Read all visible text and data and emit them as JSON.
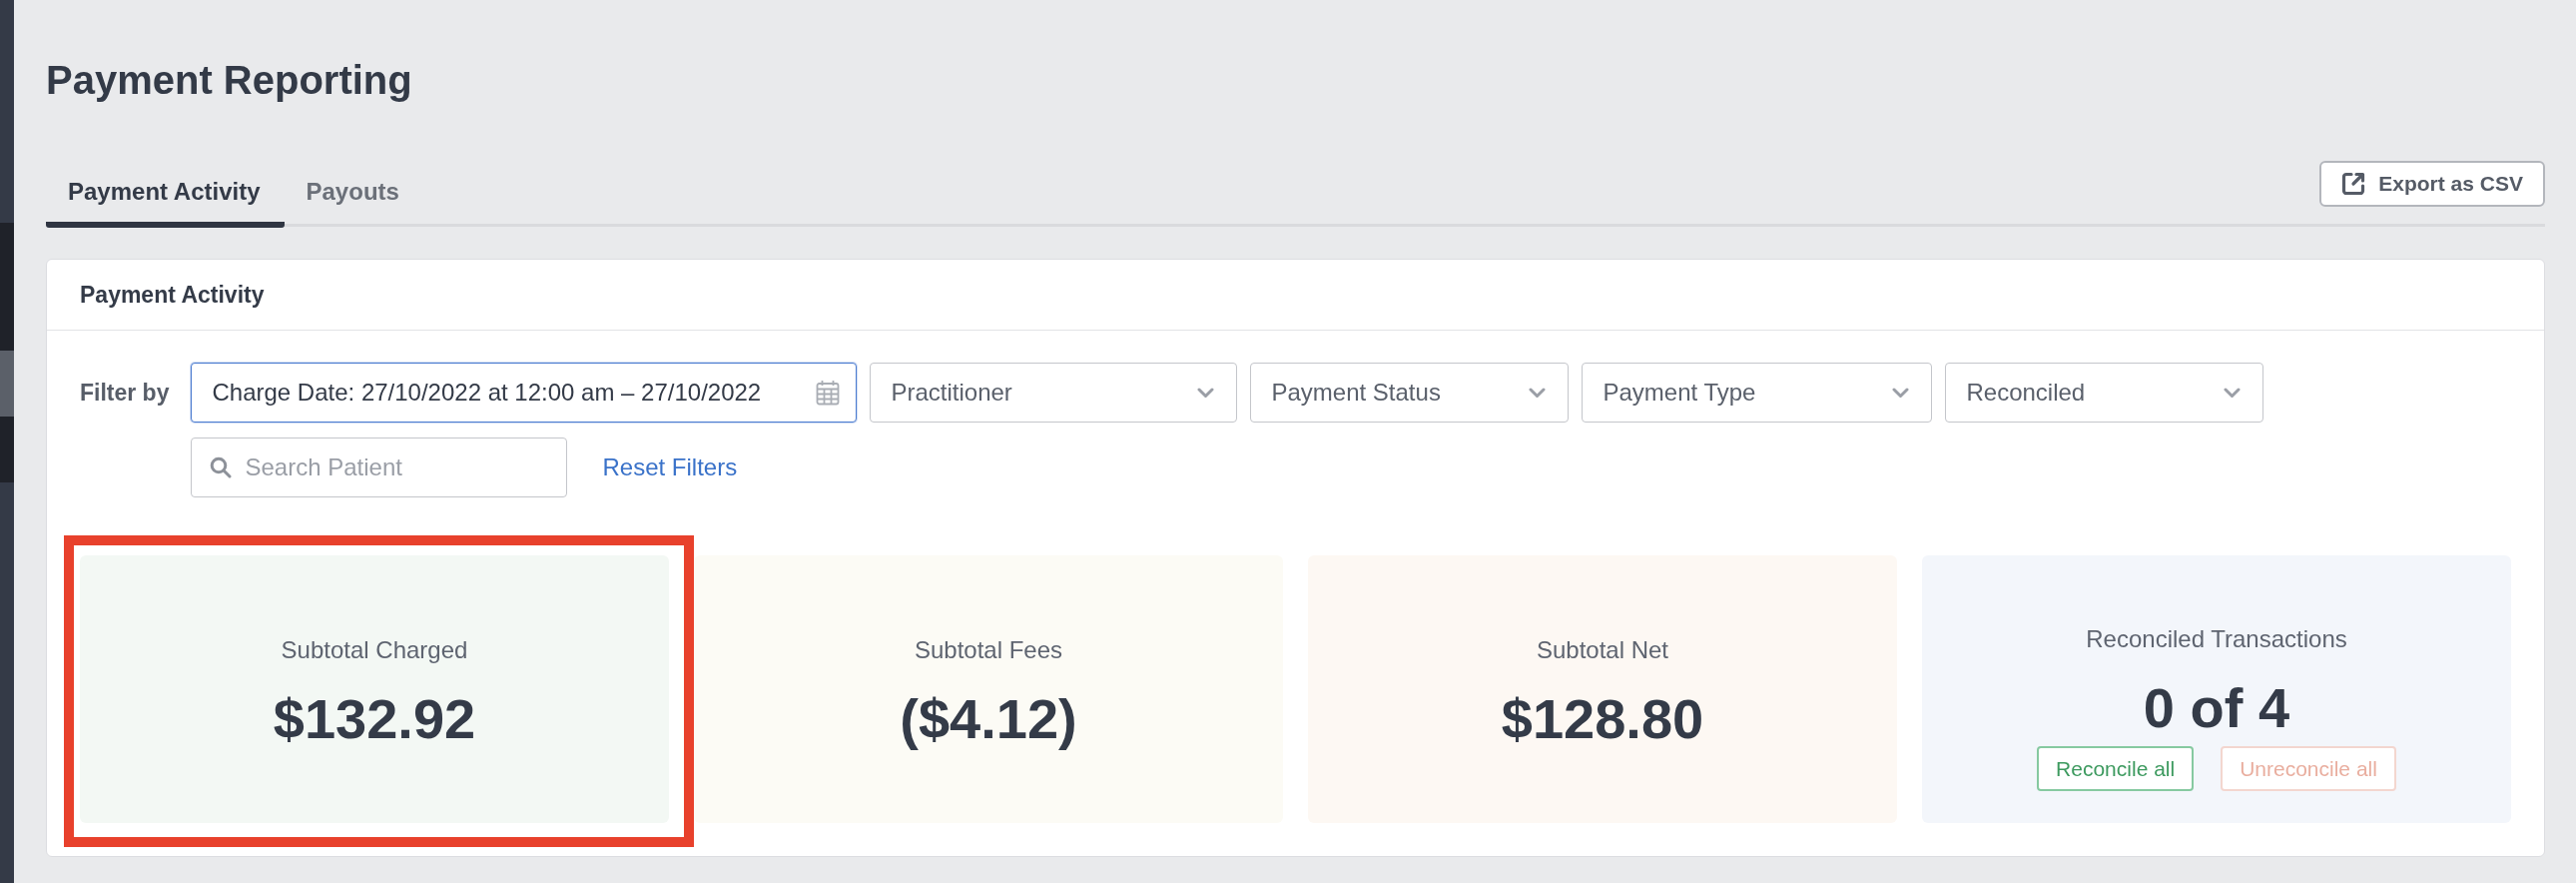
{
  "page": {
    "title": "Payment Reporting"
  },
  "tabs": [
    {
      "label": "Payment Activity",
      "selected": true
    },
    {
      "label": "Payouts",
      "selected": false
    }
  ],
  "export_button": {
    "label": "Export as CSV"
  },
  "panel": {
    "title": "Payment Activity",
    "filters": {
      "label": "Filter by",
      "date_range": {
        "value": "Charge Date: 27/10/2022 at 12:00 am – 27/10/2022",
        "focused": true
      },
      "dropdowns": [
        {
          "placeholder": "Practitioner"
        },
        {
          "placeholder": "Payment Status"
        },
        {
          "placeholder": "Payment Type"
        },
        {
          "placeholder": "Reconciled"
        }
      ],
      "search": {
        "placeholder": "Search Patient"
      },
      "reset_link": "Reset Filters"
    },
    "stats": [
      {
        "label": "Subtotal Charged",
        "value": "$132.92",
        "color": "#f3f8f4",
        "highlighted": true
      },
      {
        "label": "Subtotal Fees",
        "value": "($4.12)",
        "color": "#fcfbf5",
        "highlighted": false
      },
      {
        "label": "Subtotal Net",
        "value": "$128.80",
        "color": "#fdf8f3",
        "highlighted": false
      },
      {
        "label": "Reconciled Transactions",
        "value": "0 of 4",
        "color": "#f3f6fb",
        "highlighted": false,
        "actions": [
          {
            "label": "Reconcile all",
            "kind": "reconcile",
            "disabled": false
          },
          {
            "label": "Unreconcile all",
            "kind": "unreconcile",
            "disabled": true
          }
        ]
      }
    ]
  }
}
